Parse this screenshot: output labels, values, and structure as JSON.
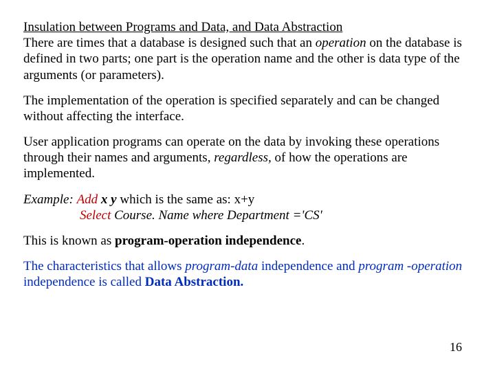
{
  "heading": "Insulation between Programs and Data, and Data Abstraction",
  "p1_a": "There are times that a database is designed such that an ",
  "p1_op": "operation",
  "p1_b": " on the database is defined in two parts; one part is the operation name and the other is data type of the arguments (or parameters).",
  "p2": "The implementation of the operation is specified separately and can be changed without affecting the interface.",
  "p3_a": "User application programs can operate on the data by invoking these operations through their names and arguments, ",
  "p3_regardless": "regardless,",
  "p3_b": " of how the operations are implemented.",
  "ex_label": "Example:",
  "ex_add": "Add",
  "ex_xy": "x y",
  "ex_same": "  which is the same as: x+y",
  "ex_select": "Select",
  "ex_query": " Course. Name where Department ='CS'",
  "p5_a": "This is known as ",
  "p5_term": "program-operation independence",
  "p5_b": ".",
  "p6_a": "The characteristics that allows ",
  "p6_pd": "program-data",
  "p6_b": " independence and ",
  "p6_po_a": "program -operation",
  "p6_c": " independence is called ",
  "p6_da": "Data Abstraction.",
  "page_number": "16"
}
